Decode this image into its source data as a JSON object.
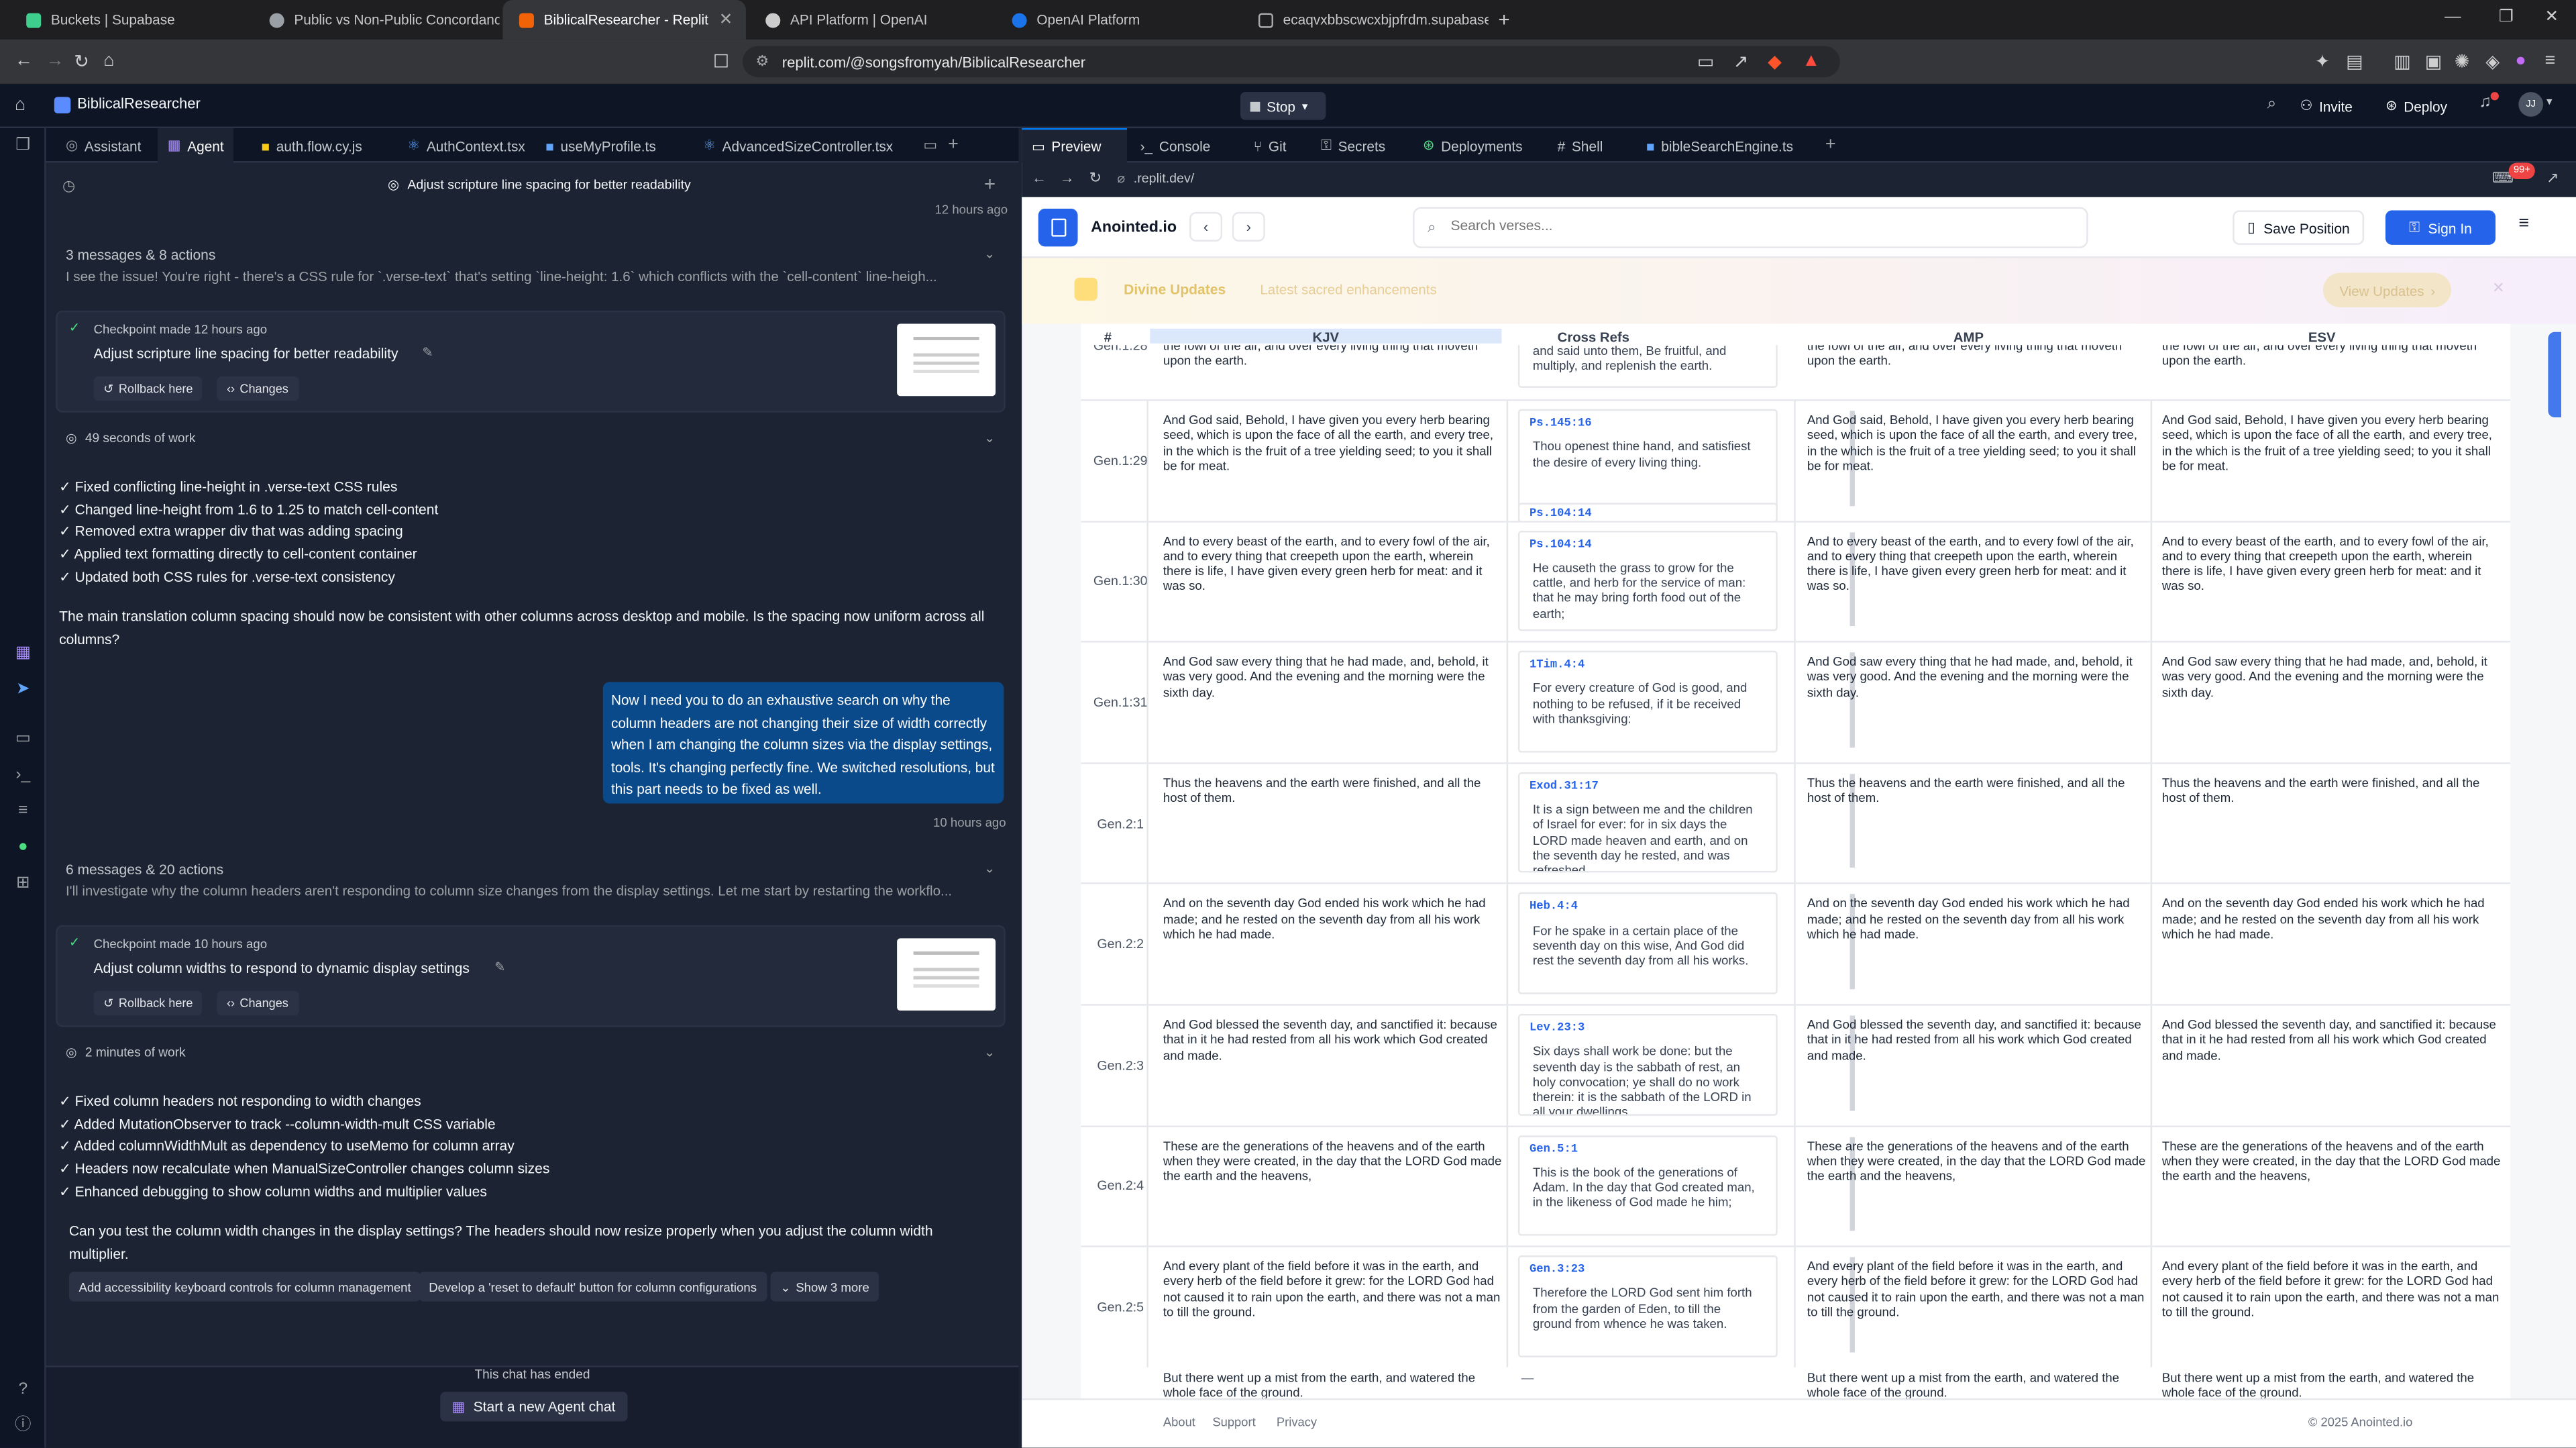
{
  "browser": {
    "tabs": [
      {
        "title": "Buckets | Supabase"
      },
      {
        "title": "Public vs Non-Public Concordance"
      },
      {
        "title": "BiblicalResearcher - Replit"
      },
      {
        "title": "API Platform | OpenAI"
      },
      {
        "title": "OpenAI Platform"
      },
      {
        "title": "ecaqvxbbscwcxbjpfrdm.supabase.co/"
      }
    ],
    "url": "replit.com/@songsfromyah/BiblicalResearcher"
  },
  "replit": {
    "project_name": "BiblicalResearcher",
    "stop_label": "Stop",
    "invite_label": "Invite",
    "deploy_label": "Deploy",
    "avatar_initials": "JJ",
    "left_tabs": [
      "Assistant",
      "Agent",
      "auth.flow.cy.js",
      "AuthContext.tsx",
      "useMyProfile.ts",
      "AdvancedSizeController.tsx"
    ],
    "right_tabs": [
      "Preview",
      "Console",
      "Git",
      "Secrets",
      "Deployments",
      "Shell",
      "bibleSearchEngine.ts"
    ],
    "preview_url": ".replit.dev/",
    "notif_badge": "99+"
  },
  "chat": {
    "history_item": "Adjust scripture line spacing for better readability",
    "time_1": "12 hours ago",
    "group_1_summary": "3 messages & 8 actions",
    "group_1_text": "I see the issue! You're right - there's a CSS rule for `.verse-text` that's setting `line-height: 1.6` which conflicts with the `cell-content` line-heigh...",
    "checkpoint_1_title": "Checkpoint made 12 hours ago",
    "checkpoint_1_desc": "Adjust scripture line spacing for better readability",
    "rollback_label": "Rollback here",
    "changes_label": "Changes",
    "work_1": "49 seconds of work",
    "work_1_items": [
      "✓ Fixed conflicting line-height in .verse-text CSS rules",
      "✓ Changed line-height from 1.6 to 1.25 to match cell-content",
      "✓ Removed extra wrapper div that was adding spacing",
      "✓ Applied text formatting directly to cell-content container",
      "✓ Updated both CSS rules for .verse-text consistency"
    ],
    "work_1_question": "The main translation column spacing should now be consistent with other columns across desktop and mobile. Is the spacing now uniform across all columns?",
    "user_message": "Now I need you to do an exhaustive search on why the column headers are not changing their size of width correctly when I am changing the column sizes via the display settings, tools. It's changing perfectly fine. We switched resolutions, but this part needs to be fixed as well.",
    "time_2": "10 hours ago",
    "group_2_summary": "6 messages & 20 actions",
    "group_2_text": "I'll investigate why the column headers aren't responding to column size changes from the display settings. Let me start by restarting the workflo...",
    "checkpoint_2_title": "Checkpoint made 10 hours ago",
    "checkpoint_2_desc": "Adjust column widths to respond to dynamic display settings",
    "work_2": "2 minutes of work",
    "work_2_items": [
      "✓ Fixed column headers not responding to width changes",
      "✓ Added MutationObserver to track --column-width-mult CSS variable",
      "✓ Added columnWidthMult as dependency to useMemo for column array",
      "✓ Headers now recalculate when ManualSizeController changes column sizes",
      "✓ Enhanced debugging to show column widths and multiplier values"
    ],
    "work_2_question": "Can you test the column width changes in the display settings? The headers should now resize properly when you adjust the column width multiplier.",
    "suggestions": [
      "Add accessibility keyboard controls for column management",
      "Develop a 'reset to default' button for column configurations",
      "Show 3 more"
    ],
    "ended_label": "This chat has ended",
    "new_chat_label": "Start a new Agent chat"
  },
  "site": {
    "brand": "Anointed.io",
    "search_placeholder": "Search verses...",
    "save_position_label": "Save Position",
    "sign_in_label": "Sign In",
    "banner_title": "Divine Updates",
    "banner_subtitle": "Latest sacred enhancements",
    "banner_button": "View Updates",
    "columns": [
      "#",
      "KJV",
      "Cross Refs",
      "AMP",
      "ESV"
    ],
    "top_partial": {
      "ref": "Gen.1:28",
      "kjv": "the fowl of the air, and over every living thing that moveth upon the earth.",
      "xref": "and said unto them, Be fruitful, and multiply, and replenish the earth."
    },
    "rows": [
      {
        "ref": "Gen.1:29",
        "kjv": "And God said, Behold, I have given you every herb bearing seed, which is upon the face of all the earth, and every tree, in the which is the fruit of a tree yielding seed; to you it shall be for meat.",
        "xcode": "Ps.145:16",
        "xtext": "Thou openest thine hand, and satisfiest the desire of every living thing.",
        "xcode2": "Ps.104:14"
      },
      {
        "ref": "Gen.1:30",
        "kjv": "And to every beast of the earth, and to every fowl of the air, and to every thing that creepeth upon the earth, wherein there is life, I have given every green herb for meat: and it was so.",
        "xcode": "Ps.104:14",
        "xtext": "He causeth the grass to grow for the cattle, and herb for the service of man: that he may bring forth food out of the earth;",
        "xcode2": ""
      },
      {
        "ref": "Gen.1:31",
        "kjv": "And God saw every thing that he had made, and, behold, it was very good. And the evening and the morning were the sixth day.",
        "xcode": "1Tim.4:4",
        "xtext": "For every creature of God is good, and nothing to be refused, if it be received with thanksgiving:",
        "xcode2": ""
      },
      {
        "ref": "Gen.2:1",
        "kjv": "Thus the heavens and the earth were finished, and all the host of them.",
        "xcode": "Exod.31:17",
        "xtext": "It is a sign between me and the children of Israel for ever: for in six days the LORD made heaven and earth, and on the seventh day he rested, and was refreshed.",
        "xcode2": ""
      },
      {
        "ref": "Gen.2:2",
        "kjv": "And on the seventh day God ended his work which he had made; and he rested on the seventh day from all his work which he had made.",
        "xcode": "Heb.4:4",
        "xtext": "For he spake in a certain place of the seventh day on this wise, And God did rest the seventh day from all his works.",
        "xcode2": ""
      },
      {
        "ref": "Gen.2:3",
        "kjv": "And God blessed the seventh day, and sanctified it: because that in it he had rested from all his work which God created and made.",
        "xcode": "Lev.23:3",
        "xtext": "Six days shall work be done: but the seventh day is the sabbath of rest, an holy convocation; ye shall do no work therein: it is the sabbath of the LORD in all your dwellings.",
        "xcode2": ""
      },
      {
        "ref": "Gen.2:4",
        "kjv": "These are the generations of the heavens and of the earth when they were created, in the day that the LORD God made the earth and the heavens,",
        "xcode": "Gen.5:1",
        "xtext": "This is the book of the generations of Adam. In the day that God created man, in the likeness of God made he him;",
        "xcode2": ""
      },
      {
        "ref": "Gen.2:5",
        "kjv": "And every plant of the field before it was in the earth, and every herb of the field before it grew: for the LORD God had not caused it to rain upon the earth, and there was not a man to till the ground.",
        "xcode": "Gen.3:23",
        "xtext": "Therefore the LORD God sent him forth from the garden of Eden, to till the ground from whence he was taken.",
        "xcode2": ""
      }
    ],
    "bottom_partial": {
      "kjv": "But there went up a mist from the earth, and watered the whole face of the ground.",
      "xref": "—"
    },
    "footer_links": [
      "About",
      "Support",
      "Privacy"
    ],
    "copyright": "© 2025 Anointed.io"
  }
}
